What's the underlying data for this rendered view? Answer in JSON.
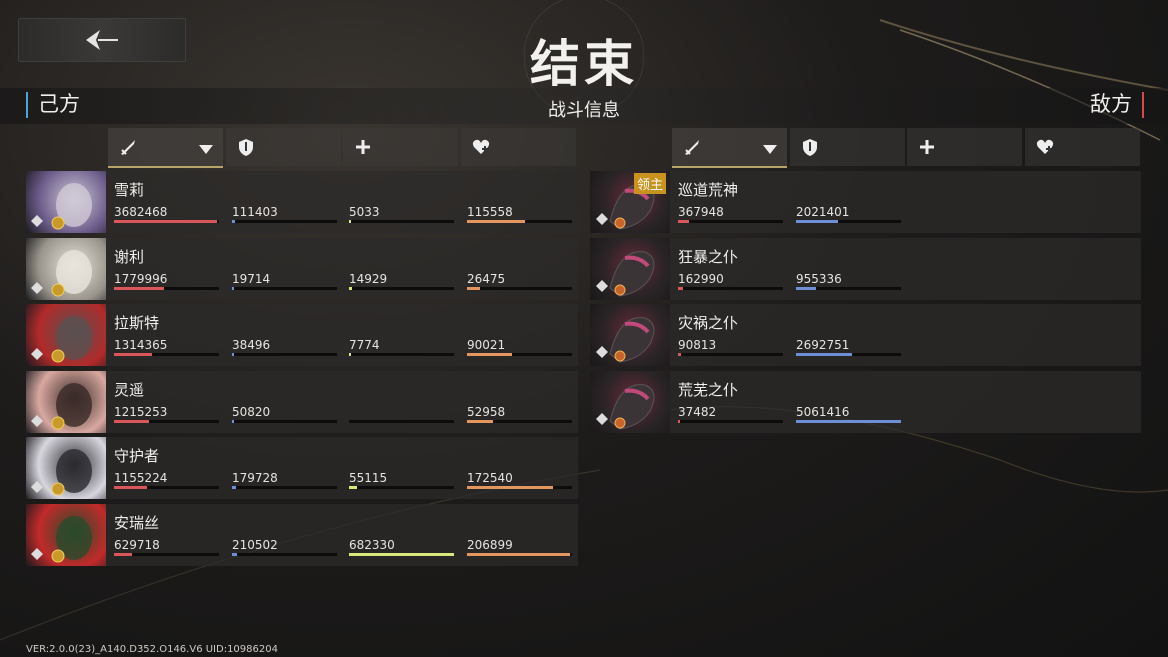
{
  "header": {
    "title": "结束",
    "center_label": "战斗信息",
    "left_side": "己方",
    "right_side": "敌方"
  },
  "colors": {
    "dmg": "#d9565b",
    "def": "#6e8fd6",
    "heal": "#d8e67a",
    "recv": "#e4965f"
  },
  "columns": [
    {
      "icon": "sword-icon",
      "active": true
    },
    {
      "icon": "shield-icon",
      "active": false
    },
    {
      "icon": "plus-icon",
      "active": false
    },
    {
      "icon": "heart-plus-icon",
      "active": false
    }
  ],
  "allies": [
    {
      "name": "雪莉",
      "values": [
        "3682468",
        "111403",
        "5033",
        "115558"
      ],
      "fill": [
        0.98,
        0.03,
        0.01,
        0.55
      ],
      "tone": [
        "#cfc9d6",
        "#6b5b8a"
      ]
    },
    {
      "name": "谢利",
      "values": [
        "1779996",
        "19714",
        "14929",
        "26475"
      ],
      "fill": [
        0.48,
        0.01,
        0.03,
        0.12
      ],
      "tone": [
        "#e8e4dc",
        "#9a958c"
      ]
    },
    {
      "name": "拉斯特",
      "values": [
        "1314365",
        "38496",
        "7774",
        "90021"
      ],
      "fill": [
        0.36,
        0.02,
        0.01,
        0.43
      ],
      "tone": [
        "#5a5050",
        "#b22a2a"
      ]
    },
    {
      "name": "灵遥",
      "values": [
        "1215253",
        "50820",
        "",
        "52958"
      ],
      "fill": [
        0.33,
        0.02,
        0,
        0.25
      ],
      "tone": [
        "#3a2a28",
        "#d8a8a0"
      ]
    },
    {
      "name": "守护者",
      "values": [
        "1155224",
        "179728",
        "55115",
        "172540"
      ],
      "fill": [
        0.31,
        0.04,
        0.08,
        0.82
      ],
      "tone": [
        "#2a2a30",
        "#d8d6de"
      ]
    },
    {
      "name": "安瑞丝",
      "values": [
        "629718",
        "210502",
        "682330",
        "206899"
      ],
      "fill": [
        0.17,
        0.05,
        1.0,
        0.98
      ],
      "tone": [
        "#2a4a2a",
        "#c22a2a"
      ]
    }
  ],
  "enemies": [
    {
      "name": "巡道荒神",
      "values": [
        "367948",
        "2021401"
      ],
      "fill": [
        0.1,
        0.4
      ],
      "badge": "领主"
    },
    {
      "name": "狂暴之仆",
      "values": [
        "162990",
        "955336"
      ],
      "fill": [
        0.05,
        0.19
      ],
      "badge": ""
    },
    {
      "name": "灾祸之仆",
      "values": [
        "90813",
        "2692751"
      ],
      "fill": [
        0.03,
        0.53
      ],
      "badge": ""
    },
    {
      "name": "荒芜之仆",
      "values": [
        "37482",
        "5061416"
      ],
      "fill": [
        0.01,
        1.0
      ],
      "badge": ""
    }
  ],
  "footer": {
    "version": "VER:2.0.0(23)_A140.D352.O146.V6   UID:10986204"
  }
}
